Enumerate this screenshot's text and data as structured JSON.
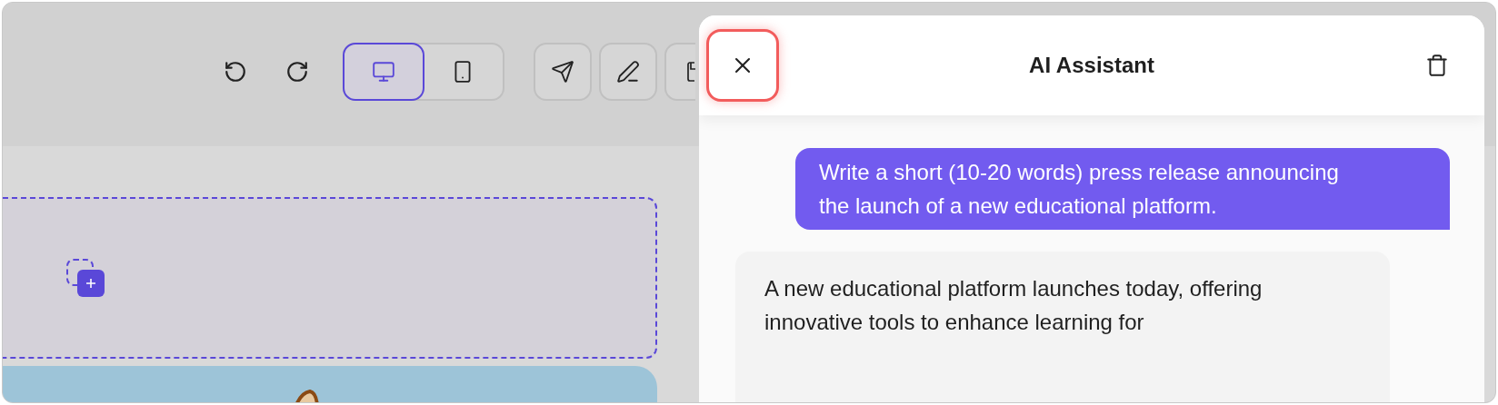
{
  "toolbar": {
    "view_modes": [
      {
        "kind": "desktop",
        "selected": true
      },
      {
        "kind": "mobile",
        "selected": false
      }
    ]
  },
  "assistant_panel": {
    "title": "AI Assistant",
    "messages": [
      {
        "kind": "user",
        "text": "Write a short (10-20 words) press release announcing the launch of a new educational platform."
      },
      {
        "kind": "assistant",
        "text": "A new educational platform launches today, offering innovative tools to enhance learning for"
      }
    ]
  }
}
